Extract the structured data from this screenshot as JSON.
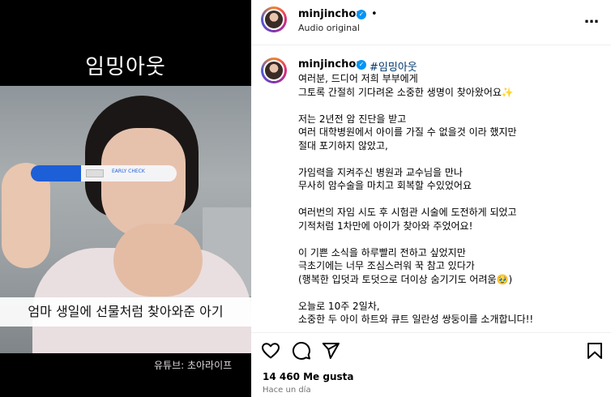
{
  "media": {
    "title": "임밍아웃",
    "subtitle": "엄마 생일에 선물처럼 찾아와준 아기",
    "credit": "유튜브: 초아라이프",
    "test_label": "EARLY CHECK"
  },
  "header": {
    "username": "minjinchoa",
    "separator": "•",
    "audio": "Audio original",
    "more": "…"
  },
  "caption": {
    "username": "minjinchoa",
    "hashtag": "#임밍아웃",
    "paragraphs": [
      [
        "여러분, 드디어 저희 부부에게",
        "그토록 간절히 기다려온 소중한 생명이 찾아왔어요✨"
      ],
      [
        "저는 2년전 암 진단을 받고",
        "여러 대학병원에서 아이를 가질 수 없을것 이라 했지만",
        "절대 포기하지 않았고,"
      ],
      [
        "가임력을 지켜주신 병원과 교수님을 만나",
        "무사히 암수술을 마치고 회복할 수있었어요"
      ],
      [
        "여러번의 자임 시도 후 시험관 시술에 도전하게 되었고",
        "기적처럼 1차만에 아이가 찾아와 주었어요!"
      ],
      [
        "이 기쁜 소식을 하루빨리 전하고 싶었지만",
        "극초기에는 너무 조심스러워 꾹 참고 있다가",
        "(행복한 입덧과 토덧으로 더이상 숨기기도 어려움🥹)"
      ],
      [
        "오늘로 10주 2일차,",
        "소중한 두 아이 하트와 큐트 일란성 쌍둥이를 소개합니다!!"
      ]
    ]
  },
  "stats": {
    "likes": "14 460 Me gusta",
    "time": "Hace un día"
  },
  "icons": {
    "like": "heart-icon",
    "comment": "comment-icon",
    "share": "share-icon",
    "save": "bookmark-icon"
  },
  "colors": {
    "verified": "#0095f6",
    "hashtag": "#00376b",
    "muted": "#737373"
  }
}
